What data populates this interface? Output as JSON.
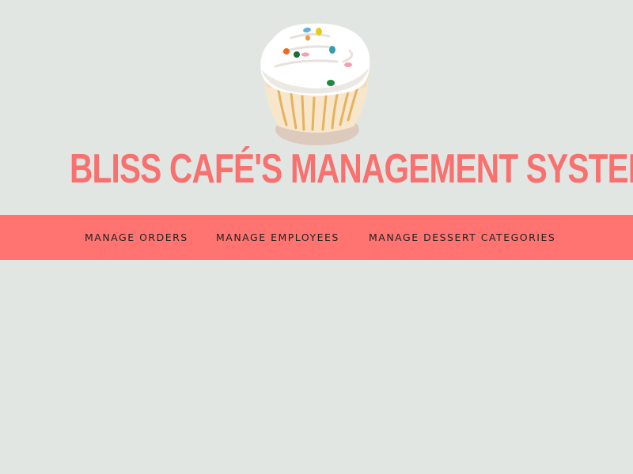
{
  "header": {
    "logo_icon": "cupcake-icon",
    "title": "BLISS CAFÉ'S MANAGEMENT SYSTEM"
  },
  "nav": {
    "items": [
      {
        "label": "MANAGE ORDERS"
      },
      {
        "label": "MANAGE EMPLOYEES"
      },
      {
        "label": "MANAGE DESSERT CATEGORIES"
      }
    ]
  },
  "colors": {
    "background": "#e2e6e3",
    "brand_coral": "#ff7470",
    "title_color": "#f8716f",
    "nav_text": "#222222"
  }
}
